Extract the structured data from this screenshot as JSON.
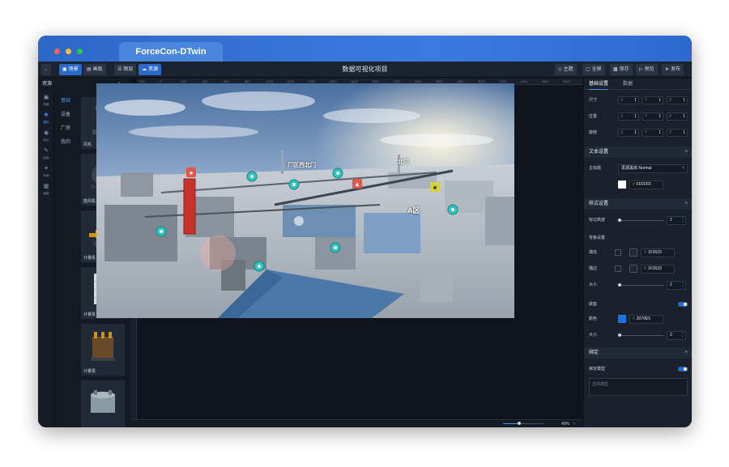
{
  "app": {
    "tab_title": "ForceCon-DTwin"
  },
  "toolbar": {
    "scene_label": "场景",
    "panel_label": "画板",
    "layer_label": "图层",
    "resource_label": "资源",
    "project_title": "数据可视化项目",
    "theme_label": "主题",
    "fullscreen_label": "全屏",
    "save_label": "保存",
    "preview_label": "预览",
    "publish_label": "发布"
  },
  "leftnav": {
    "items": [
      {
        "label": "场景",
        "icon": "scene-icon"
      },
      {
        "label": "模型",
        "icon": "model-icon"
      },
      {
        "label": "标记",
        "icon": "marker-icon"
      },
      {
        "label": "绘制",
        "icon": "draw-icon"
      },
      {
        "label": "动画",
        "icon": "animation-icon"
      },
      {
        "label": "面板",
        "icon": "panel-icon"
      }
    ]
  },
  "resource_panel": {
    "title": "资源",
    "categories": [
      "基础",
      "设备",
      "厂房",
      "我的"
    ],
    "assets": [
      {
        "label": "风机"
      },
      {
        "label": "鼓风机"
      },
      {
        "label": "计量泵"
      },
      {
        "label": "计量泵"
      },
      {
        "label": "计量泵"
      },
      {
        "label": ""
      }
    ]
  },
  "ruler": {
    "ticks": [
      "-200",
      "0",
      "200",
      "400",
      "600",
      "800",
      "1000",
      "1200",
      "1400",
      "1600",
      "1800",
      "2000",
      "2200",
      "2400",
      "2600",
      "2800",
      "3000",
      "3200",
      "3400",
      "3600",
      "3800"
    ]
  },
  "scene": {
    "labels": [
      {
        "text": "厂区西北门"
      },
      {
        "text": "北门"
      },
      {
        "text": "A区"
      }
    ]
  },
  "canvas_footer": {
    "zoom": "40%",
    "zoom_fraction": 0.4
  },
  "properties": {
    "tabs": [
      "基础设置",
      "数据"
    ],
    "size": {
      "label": "尺寸",
      "x": "1",
      "y": "1",
      "z": "1"
    },
    "position": {
      "label": "位置",
      "x": "1",
      "y": "1",
      "z": "1"
    },
    "rotation": {
      "label": "旋转",
      "x": "1",
      "y": "1",
      "z": "1"
    },
    "axis_labels": {
      "x": "X",
      "y": "Y",
      "z": "Z"
    },
    "text_section": {
      "title": "文本设置",
      "main_title_label": "主标题",
      "font": "思源黑体 Normal",
      "color": "FFFFFF",
      "color_hex": "#FFFFFF"
    },
    "style_section": {
      "title": "样式设置",
      "marker_height_label": "标记高度",
      "marker_height": "2",
      "backplate_label": "背板设置",
      "fill_label": "填充",
      "fill_color": "1F2633",
      "border_label": "描边",
      "border_color": "1F2633",
      "size_label": "大小",
      "size_value": "2",
      "base_label": "底座",
      "base_color_label": "颜色",
      "base_color": "2070E5",
      "base_color_hex": "#2070E5",
      "base_size_label": "大小",
      "base_size_value": "2"
    },
    "binding_section": {
      "title": "绑定",
      "bind_model_label": "绑定模型",
      "placeholder": "选择模型"
    }
  },
  "colors": {
    "accent": "#2c68c8",
    "titlebar": "#3a7be0",
    "panel_bg": "#1a212c"
  }
}
